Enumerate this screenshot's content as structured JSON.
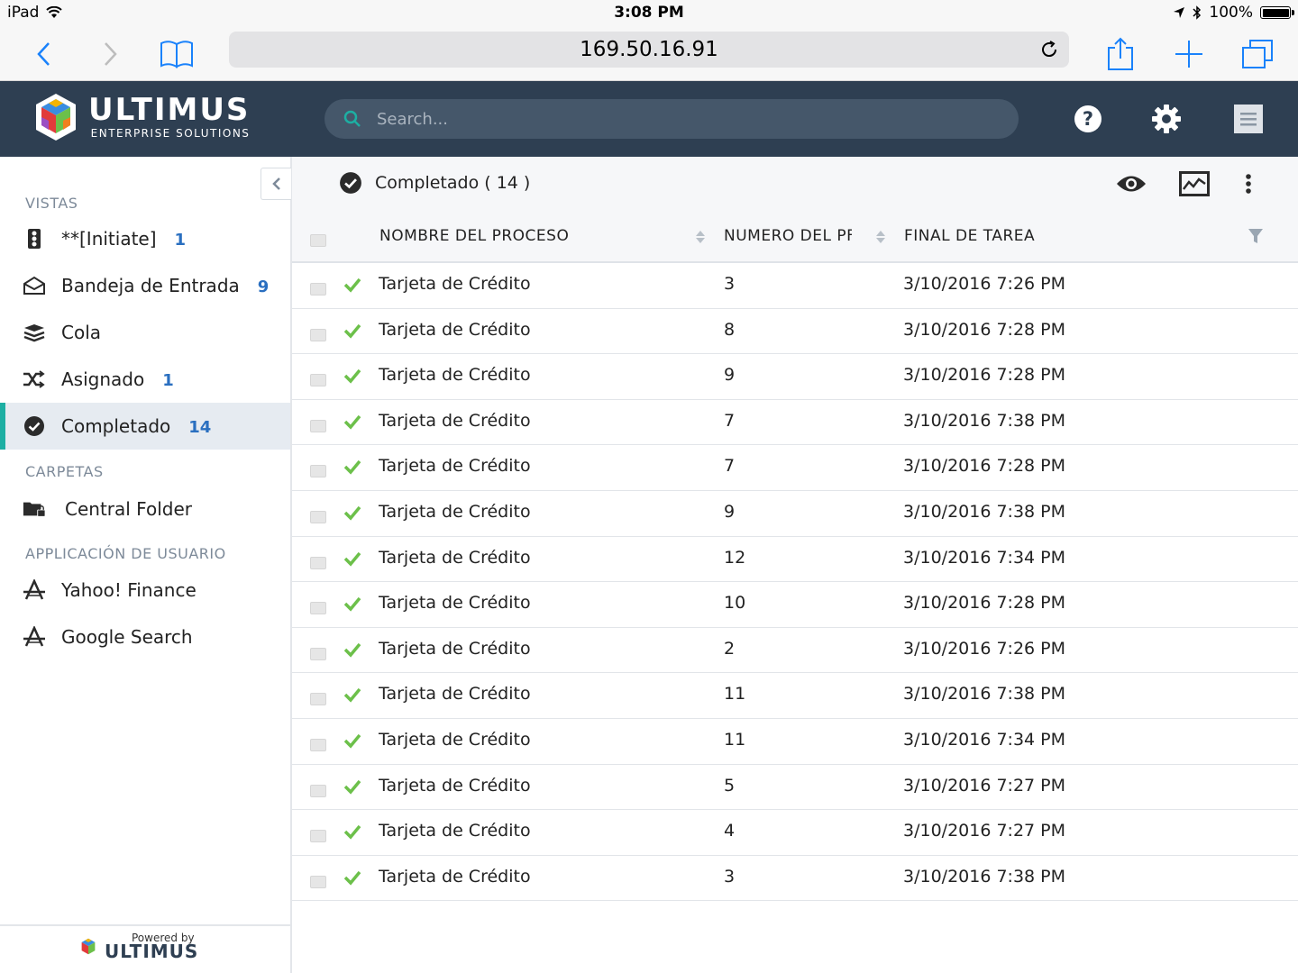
{
  "status_bar": {
    "device": "iPad",
    "time": "3:08 PM",
    "battery": "100%"
  },
  "browser": {
    "url": "169.50.16.91"
  },
  "header": {
    "brand": "ULTIMUS",
    "tagline": "ENTERPRISE SOLUTIONS",
    "search_placeholder": "Search..."
  },
  "sidebar": {
    "section_views": "VISTAS",
    "views": [
      {
        "label": "**[Initiate]",
        "count": "1",
        "icon": "traffic-light-icon"
      },
      {
        "label": "Bandeja de Entrada",
        "count": "9",
        "icon": "inbox-envelope-icon"
      },
      {
        "label": "Cola",
        "count": "",
        "icon": "stack-icon"
      },
      {
        "label": "Asignado",
        "count": "1",
        "icon": "shuffle-icon"
      },
      {
        "label": "Completado",
        "count": "14",
        "icon": "check-circle-icon"
      }
    ],
    "section_folders": "CARPETAS",
    "folders": [
      {
        "label": "Central Folder",
        "icon": "locked-folder-icon"
      }
    ],
    "section_apps": "APPLICACIÓN DE USUARIO",
    "apps": [
      {
        "label": "Yahoo! Finance",
        "icon": "app-icon"
      },
      {
        "label": "Google Search",
        "icon": "app-icon"
      }
    ],
    "powered_by": "Powered by",
    "powered_brand": "ULTIMUS"
  },
  "main": {
    "title": "Completado ( 14 )",
    "columns": [
      "NOMBRE DEL PROCESO",
      "NUMERO DEL PF",
      "FINAL DE TAREA"
    ],
    "rows": [
      {
        "name": "Tarjeta de Crédito",
        "number": "3",
        "end": "3/10/2016 7:26 PM"
      },
      {
        "name": "Tarjeta de Crédito",
        "number": "8",
        "end": "3/10/2016 7:28 PM"
      },
      {
        "name": "Tarjeta de Crédito",
        "number": "9",
        "end": "3/10/2016 7:28 PM"
      },
      {
        "name": "Tarjeta de Crédito",
        "number": "7",
        "end": "3/10/2016 7:38 PM"
      },
      {
        "name": "Tarjeta de Crédito",
        "number": "7",
        "end": "3/10/2016 7:28 PM"
      },
      {
        "name": "Tarjeta de Crédito",
        "number": "9",
        "end": "3/10/2016 7:38 PM"
      },
      {
        "name": "Tarjeta de Crédito",
        "number": "12",
        "end": "3/10/2016 7:34 PM"
      },
      {
        "name": "Tarjeta de Crédito",
        "number": "10",
        "end": "3/10/2016 7:28 PM"
      },
      {
        "name": "Tarjeta de Crédito",
        "number": "2",
        "end": "3/10/2016 7:26 PM"
      },
      {
        "name": "Tarjeta de Crédito",
        "number": "11",
        "end": "3/10/2016 7:38 PM"
      },
      {
        "name": "Tarjeta de Crédito",
        "number": "11",
        "end": "3/10/2016 7:34 PM"
      },
      {
        "name": "Tarjeta de Crédito",
        "number": "5",
        "end": "3/10/2016 7:27 PM"
      },
      {
        "name": "Tarjeta de Crédito",
        "number": "4",
        "end": "3/10/2016 7:27 PM"
      },
      {
        "name": "Tarjeta de Crédito",
        "number": "3",
        "end": "3/10/2016 7:38 PM"
      }
    ]
  },
  "colors": {
    "header_bg": "#2e3f52",
    "accent": "#1dafa3",
    "count": "#2a6fc0",
    "check": "#6cc04a",
    "ios_blue": "#1a82fb"
  }
}
